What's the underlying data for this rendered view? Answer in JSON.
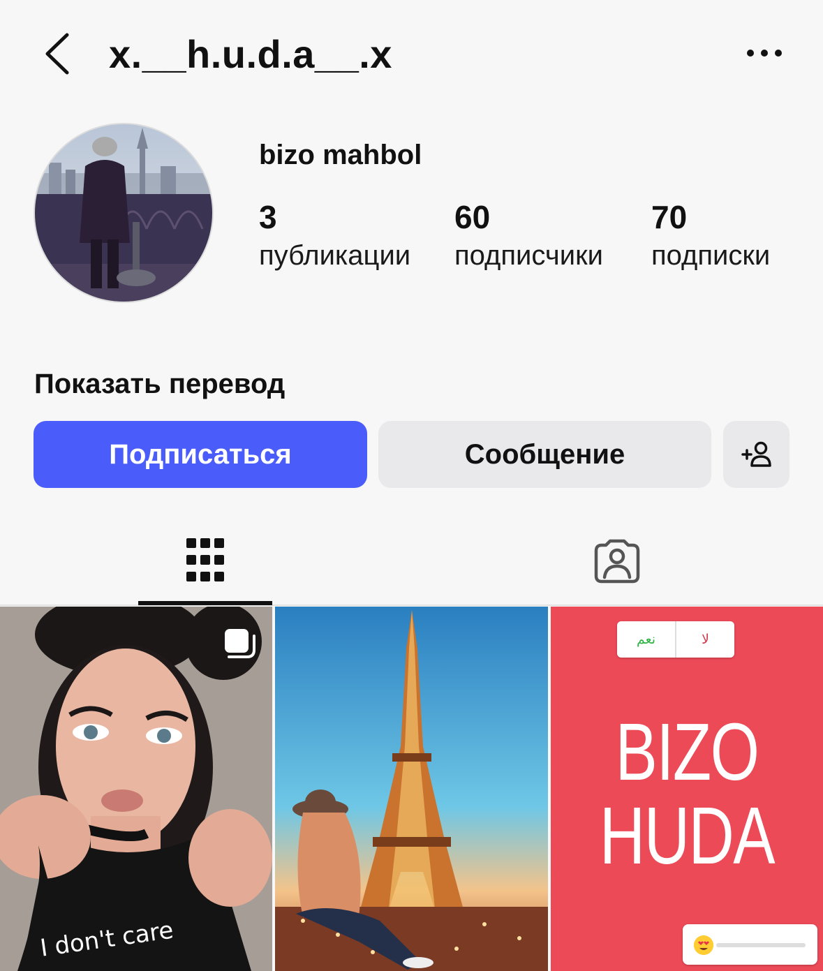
{
  "header": {
    "username": "x.__h.u.d.a__.x",
    "back_icon": "chevron-left-icon",
    "more_icon": "more-horizontal-icon"
  },
  "profile": {
    "display_name": "bizo mahbol",
    "stats": {
      "posts": {
        "value": "3",
        "label": "публикации"
      },
      "followers": {
        "value": "60",
        "label": "подписчики"
      },
      "following": {
        "value": "70",
        "label": "подписки"
      }
    },
    "show_translation": "Показать перевод"
  },
  "actions": {
    "follow_label": "Подписаться",
    "message_label": "Сообщение",
    "suggest_icon": "add-person-icon"
  },
  "tabs": {
    "grid_icon": "grid-icon",
    "tagged_icon": "tagged-person-icon",
    "active": "grid"
  },
  "posts": [
    {
      "type": "image",
      "subject": "portrait",
      "shirt_text": "I don't care",
      "multi_icon": "carousel-icon"
    },
    {
      "type": "image",
      "subject": "eiffel-tower"
    },
    {
      "type": "story-text",
      "line1": "BIZO",
      "line2": "HUDA",
      "poll_yes": "نعم",
      "poll_no": "لا",
      "emoji_slider": "heart-eyes-emoji"
    }
  ],
  "colors": {
    "background": "#f7f7f7",
    "follow_button": "#4a5cfa",
    "secondary_button": "#e9e9ec",
    "post3_background": "#ec4a57"
  }
}
